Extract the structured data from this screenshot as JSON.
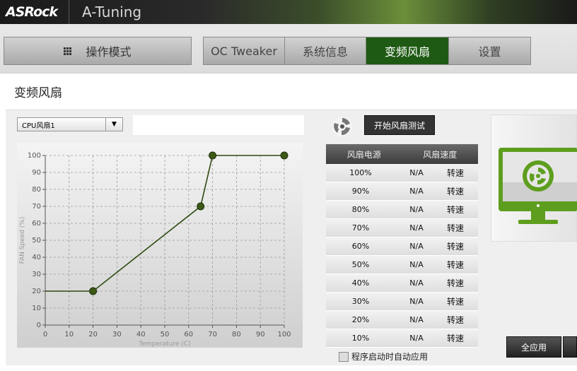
{
  "app": {
    "logo": "ASRock",
    "title": "A-Tuning"
  },
  "nav": {
    "mode_label": "操作模式",
    "tabs": [
      {
        "label": "OC Tweaker",
        "active": false
      },
      {
        "label": "系统信息",
        "active": false
      },
      {
        "label": "变频风扇",
        "active": true
      },
      {
        "label": "设置",
        "active": false
      }
    ]
  },
  "page": {
    "title": "变频风扇"
  },
  "fan_select": {
    "value": "CPU风扇1"
  },
  "test_button": {
    "label": "开始风扇测试"
  },
  "table": {
    "headers": [
      "风扇电源",
      "风扇速度"
    ],
    "rows": [
      {
        "power": "100%",
        "speed": "N/A",
        "unit": "转速"
      },
      {
        "power": "90%",
        "speed": "N/A",
        "unit": "转速"
      },
      {
        "power": "80%",
        "speed": "N/A",
        "unit": "转速"
      },
      {
        "power": "70%",
        "speed": "N/A",
        "unit": "转速"
      },
      {
        "power": "60%",
        "speed": "N/A",
        "unit": "转速"
      },
      {
        "power": "50%",
        "speed": "N/A",
        "unit": "转速"
      },
      {
        "power": "40%",
        "speed": "N/A",
        "unit": "转速"
      },
      {
        "power": "30%",
        "speed": "N/A",
        "unit": "转速"
      },
      {
        "power": "20%",
        "speed": "N/A",
        "unit": "转速"
      },
      {
        "power": "10%",
        "speed": "N/A",
        "unit": "转速"
      }
    ]
  },
  "auto_apply": {
    "label": "程序启动时自动应用",
    "checked": false
  },
  "apply_button": {
    "label": "全应用"
  },
  "colors": {
    "accent": "#1f5a14",
    "curve": "#2d4a10",
    "point": "#3c5a16",
    "monitor": "#5e9e1e"
  },
  "chart_data": {
    "type": "line",
    "xlabel": "Temperature (C)",
    "ylabel": "FAN Speed (%)",
    "xlim": [
      0,
      100
    ],
    "ylim": [
      0,
      100
    ],
    "xticks": [
      0,
      10,
      20,
      30,
      40,
      50,
      60,
      70,
      80,
      90,
      100
    ],
    "yticks": [
      0,
      10,
      20,
      30,
      40,
      50,
      60,
      70,
      80,
      90,
      100
    ],
    "grid": true,
    "x": [
      0,
      20,
      65,
      70,
      100
    ],
    "y": [
      20,
      20,
      70,
      100,
      100
    ],
    "control_points": [
      {
        "x": 20,
        "y": 20
      },
      {
        "x": 65,
        "y": 70
      },
      {
        "x": 70,
        "y": 100
      },
      {
        "x": 100,
        "y": 100
      }
    ]
  }
}
